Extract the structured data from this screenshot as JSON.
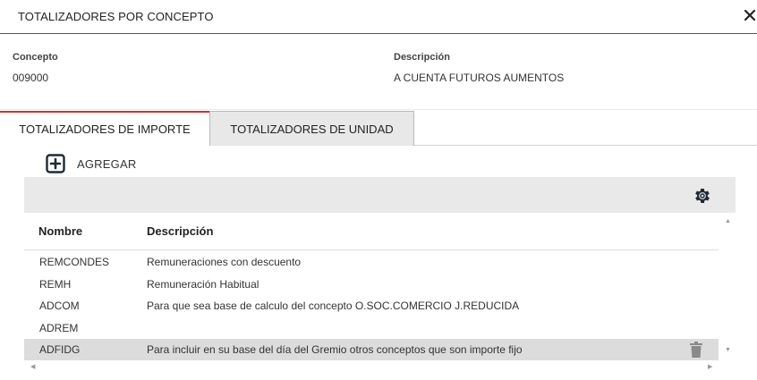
{
  "modal": {
    "title": "TOTALIZADORES POR CONCEPTO"
  },
  "fields": {
    "concepto_label": "Concepto",
    "concepto_value": "009000",
    "descripcion_label": "Descripción",
    "descripcion_value": "A CUENTA FUTUROS AUMENTOS"
  },
  "tabs": [
    {
      "label": "TOTALIZADORES DE IMPORTE",
      "active": true
    },
    {
      "label": "TOTALIZADORES DE UNIDAD",
      "active": false
    }
  ],
  "toolbar": {
    "add_label": "AGREGAR"
  },
  "grid": {
    "columns": [
      "Nombre",
      "Descripción"
    ],
    "rows": [
      {
        "nombre": "REMCONDES",
        "descripcion": "Remuneraciones con descuento"
      },
      {
        "nombre": "REMH",
        "descripcion": "Remuneración Habitual"
      },
      {
        "nombre": "ADCOM",
        "descripcion": "Para que sea base de calculo del concepto O.SOC.COMERCIO J.REDUCIDA"
      },
      {
        "nombre": "ADREM",
        "descripcion": ""
      },
      {
        "nombre": "ADFIDG",
        "descripcion": "Para incluir en su base del día del Gremio otros conceptos que son importe fijo"
      }
    ],
    "selected_row": 4
  },
  "icons": {
    "close": "close-icon",
    "add": "plus-square-icon",
    "settings": "gear-icon",
    "delete": "trash-icon"
  },
  "colors": {
    "active_tab_accent": "#d32f2f",
    "inactive_tab_bg": "#e8e8e8",
    "toolbar_bg": "#e9e9e9",
    "selected_row_bg": "#dcdcdc"
  }
}
